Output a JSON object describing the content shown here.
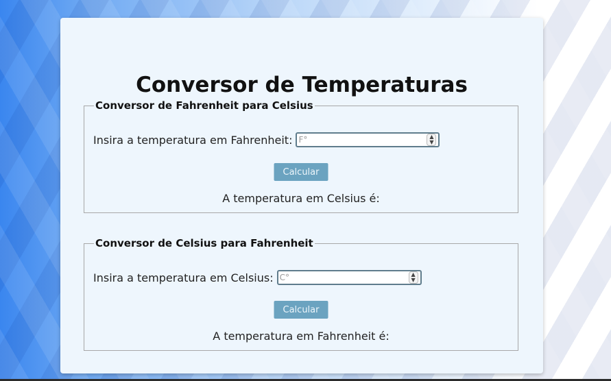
{
  "page": {
    "title": "Conversor de Temperaturas"
  },
  "converters": [
    {
      "legend": "Conversor de Fahrenheit para Celsius",
      "input_label": "Insira a temperatura em Fahrenheit:",
      "input_placeholder": "F°",
      "input_value": "",
      "button_label": "Calcular",
      "result_text": "A temperatura em Celsius é:"
    },
    {
      "legend": "Conversor de Celsius para Fahrenheit",
      "input_label": "Insira a temperatura em Celsius:",
      "input_placeholder": "C°",
      "input_value": "",
      "button_label": "Calcular",
      "result_text": "A temperatura em Fahrenheit é:"
    }
  ],
  "icons": {
    "spinner_up": "▲",
    "spinner_down": "▼"
  },
  "colors": {
    "button_bg": "#6ba3c0",
    "card_bg": "#eef6fd",
    "input_border": "#5f7c8c"
  }
}
